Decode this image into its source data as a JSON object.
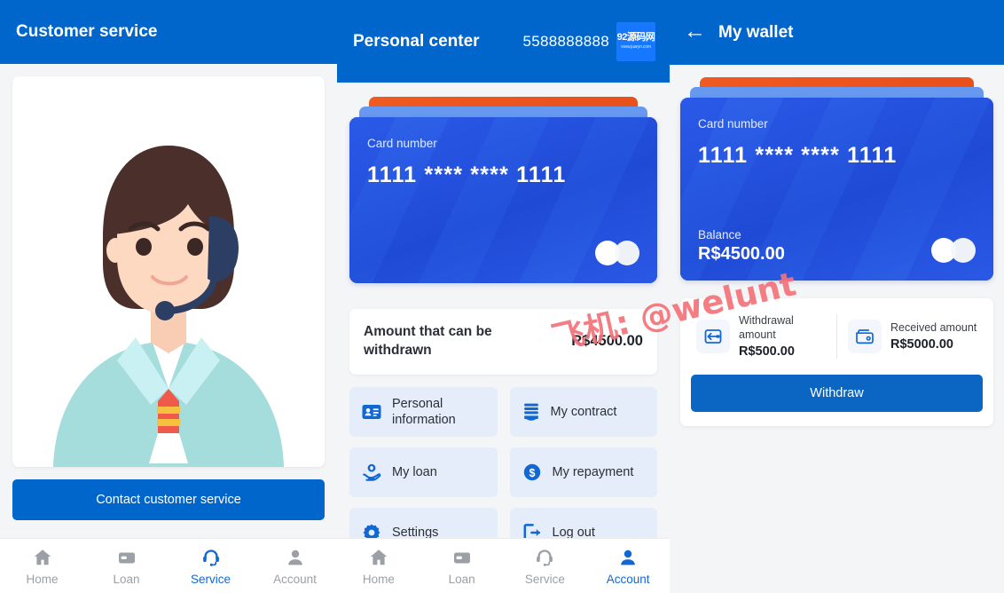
{
  "colors": {
    "brand_blue": "#0066cc",
    "card_blue": "#2554e0",
    "card_top_orange": "#ef5a20",
    "card_top_lightblue": "#6699ef",
    "tile_bg": "#e4edf9",
    "accent_active": "#1268d3",
    "watermark_pink": "#f4727a",
    "page_bg": "#f4f5f7"
  },
  "panel1": {
    "header": {
      "title": "Customer service"
    },
    "illustration": {
      "name": "customer-service-agent-illustration"
    },
    "contact_button": {
      "label": "Contact customer service"
    },
    "tabbar": [
      {
        "label": "Home",
        "icon": "home-icon",
        "active": false
      },
      {
        "label": "Loan",
        "icon": "wallet-icon",
        "active": false
      },
      {
        "label": "Service",
        "icon": "headset-icon",
        "active": true
      },
      {
        "label": "Account",
        "icon": "person-icon",
        "active": false
      }
    ]
  },
  "panel2": {
    "header": {
      "title": "Personal center",
      "phone": "5588888888",
      "logo_line1": "92源码网",
      "logo_line2": "www.juaryn.com"
    },
    "card": {
      "label": "Card number",
      "number": "1111 **** **** 1111"
    },
    "amount": {
      "label": "Amount that can be withdrawn",
      "value": "R$4500.00"
    },
    "menu": [
      {
        "label": "Personal information",
        "icon": "id-card-icon"
      },
      {
        "label": "My contract",
        "icon": "contract-icon"
      },
      {
        "label": "My loan",
        "icon": "loan-hand-icon"
      },
      {
        "label": "My repayment",
        "icon": "dollar-circle-icon"
      },
      {
        "label": "Settings",
        "icon": "gear-icon"
      },
      {
        "label": "Log out",
        "icon": "logout-icon"
      }
    ],
    "tabbar": [
      {
        "label": "Home",
        "icon": "home-icon",
        "active": false
      },
      {
        "label": "Loan",
        "icon": "wallet-icon",
        "active": false
      },
      {
        "label": "Service",
        "icon": "headset-icon",
        "active": false
      },
      {
        "label": "Account",
        "icon": "person-icon",
        "active": true
      }
    ]
  },
  "panel3": {
    "header": {
      "title": "My wallet",
      "back_icon": "back-arrow-icon"
    },
    "card": {
      "label": "Card number",
      "number": "1111 **** **** 1111",
      "balance_label": "Balance",
      "balance_value": "R$4500.00"
    },
    "withdrawal": {
      "amount_label": "Withdrawal amount",
      "amount_value": "R$500.00",
      "received_label": "Received amount",
      "received_value": "R$5000.00",
      "button_label": "Withdraw",
      "amount_icon": "withdraw-arrow-icon",
      "received_icon": "wallet-received-icon"
    }
  },
  "watermark": {
    "text": "飞机: @welunt"
  }
}
